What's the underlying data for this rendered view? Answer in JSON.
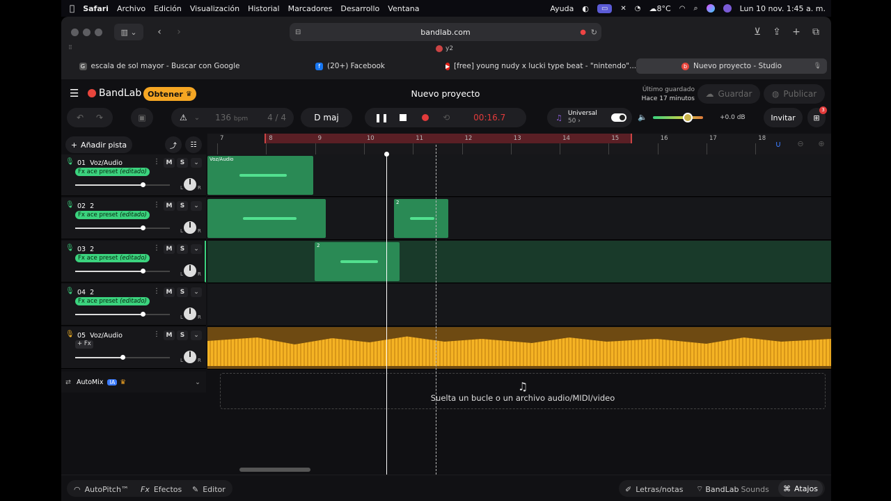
{
  "menubar": {
    "apple": "",
    "items": [
      "Safari",
      "Archivo",
      "Edición",
      "Visualización",
      "Historial",
      "Marcadores",
      "Desarrollo",
      "Ventana"
    ],
    "help": "Ayuda",
    "weather": "8°C",
    "datetime": "Lun 10 nov.  1:45 a. m."
  },
  "browser": {
    "url": "bandlab.com",
    "profile_label": "y2",
    "tabs": [
      {
        "title": "escala de sol mayor - Buscar con Google",
        "icon": "google-icon",
        "color": "#555"
      },
      {
        "title": "(20+) Facebook",
        "icon": "facebook-icon",
        "color": "#1877f2"
      },
      {
        "title": "[free] young nudy x lucki type beat - \"nintendo\"...",
        "icon": "youtube-icon",
        "color": "#e62117"
      },
      {
        "title": "Nuevo proyecto - Studio",
        "icon": "bandlab-icon",
        "color": "#e8453c",
        "active": true
      }
    ]
  },
  "header": {
    "logo": "BandLab",
    "obtener": "Obtener",
    "project_title": "Nuevo proyecto",
    "last_saved_label": "Último guardado",
    "last_saved_time": "Hace 17 minutos",
    "save": "Guardar",
    "publish": "Publicar"
  },
  "transport": {
    "bpm": "136",
    "bpm_unit": "bpm",
    "time_sig": "4 / 4",
    "key": "D maj",
    "time": "00:16.7",
    "instrument_name": "Universal",
    "instrument_value": "50",
    "volume_db": "+0.0 dB",
    "volume_level": 0.7,
    "invite": "Invitar",
    "gift_count": "3"
  },
  "tracks_panel": {
    "add_track": "Añadir pista",
    "automix_label": "AutoMix",
    "automix_badge": "IA"
  },
  "ruler": [
    "7",
    "8",
    "9",
    "10",
    "11",
    "12",
    "13",
    "14",
    "15",
    "16",
    "17",
    "18"
  ],
  "tracks": [
    {
      "num": "01",
      "name": "Voz/Audio",
      "fx_name": "ace preset",
      "fx_state": "(editado)",
      "fx_prefix": "Fx",
      "volume": 0.71,
      "mute": "M",
      "solo": "S",
      "clips": [
        {
          "label": "Voz/Audio"
        }
      ]
    },
    {
      "num": "02",
      "name": "2",
      "fx_name": "ace preset",
      "fx_state": "(editado)",
      "fx_prefix": "Fx",
      "volume": 0.71,
      "mute": "M",
      "solo": "S",
      "clips": [
        {
          "label": ""
        },
        {
          "label": "2"
        }
      ]
    },
    {
      "num": "03",
      "name": "2",
      "fx_name": "ace preset",
      "fx_state": "(editado)",
      "fx_prefix": "Fx",
      "volume": 0.71,
      "mute": "M",
      "solo": "S",
      "clips": [
        {
          "label": "2"
        }
      ]
    },
    {
      "num": "04",
      "name": "2",
      "fx_name": "ace preset",
      "fx_state": "(editado)",
      "fx_prefix": "Fx",
      "volume": 0.71,
      "mute": "M",
      "solo": "S",
      "clips": []
    },
    {
      "num": "05",
      "name": "Voz/Audio",
      "fx_plain": "+ Fx",
      "volume": 0.5,
      "mute": "M",
      "solo": "S",
      "clips": []
    }
  ],
  "drop_zone": "Suelta un bucle o un archivo audio/MIDI/video",
  "footer": {
    "autopitch": "AutoPitch™",
    "effects": "Efectos",
    "editor": "Editor",
    "lyrics": "Letras/notas",
    "sounds_brand": "BandLab",
    "sounds": "Sounds",
    "shortcuts": "Atajos"
  },
  "colors": {
    "accent_green": "#3bd37e",
    "accent_orange": "#f5b324",
    "record_red": "#e23b3b",
    "obtener_bg": "#f5a623"
  }
}
